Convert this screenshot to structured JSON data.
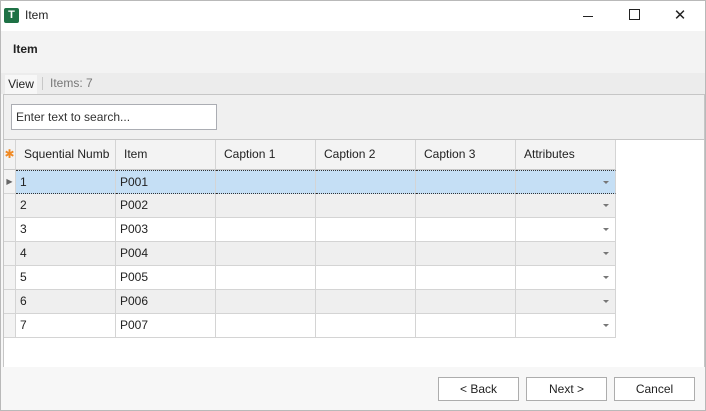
{
  "window": {
    "title": "Item",
    "app_icon_letter": "T",
    "minimize_glyph": "",
    "close_glyph": "✕"
  },
  "header": {
    "title": "Item"
  },
  "tabbar": {
    "view_tab": "View",
    "items_count": "Items: 7"
  },
  "search": {
    "placeholder": "Enter text to search..."
  },
  "grid": {
    "columns": [
      "Squential Numb",
      "Item",
      "Caption 1",
      "Caption 2",
      "Caption 3",
      "Attributes"
    ],
    "new_row_marker": "✱",
    "current_row_marker": "▶",
    "rows": [
      {
        "seq": "1",
        "item": "P001",
        "caption1": "",
        "caption2": "",
        "caption3": "",
        "attributes": ""
      },
      {
        "seq": "2",
        "item": "P002",
        "caption1": "",
        "caption2": "",
        "caption3": "",
        "attributes": ""
      },
      {
        "seq": "3",
        "item": "P003",
        "caption1": "",
        "caption2": "",
        "caption3": "",
        "attributes": ""
      },
      {
        "seq": "4",
        "item": "P004",
        "caption1": "",
        "caption2": "",
        "caption3": "",
        "attributes": ""
      },
      {
        "seq": "5",
        "item": "P005",
        "caption1": "",
        "caption2": "",
        "caption3": "",
        "attributes": ""
      },
      {
        "seq": "6",
        "item": "P006",
        "caption1": "",
        "caption2": "",
        "caption3": "",
        "attributes": ""
      },
      {
        "seq": "7",
        "item": "P007",
        "caption1": "",
        "caption2": "",
        "caption3": "",
        "attributes": ""
      }
    ]
  },
  "footer": {
    "back_label": "< Back",
    "next_label": "Next >",
    "cancel_label": "Cancel"
  },
  "colors": {
    "app_icon": "#1e7145",
    "selected_row": "#c5dff5",
    "new_row_marker": "#f08a24"
  }
}
